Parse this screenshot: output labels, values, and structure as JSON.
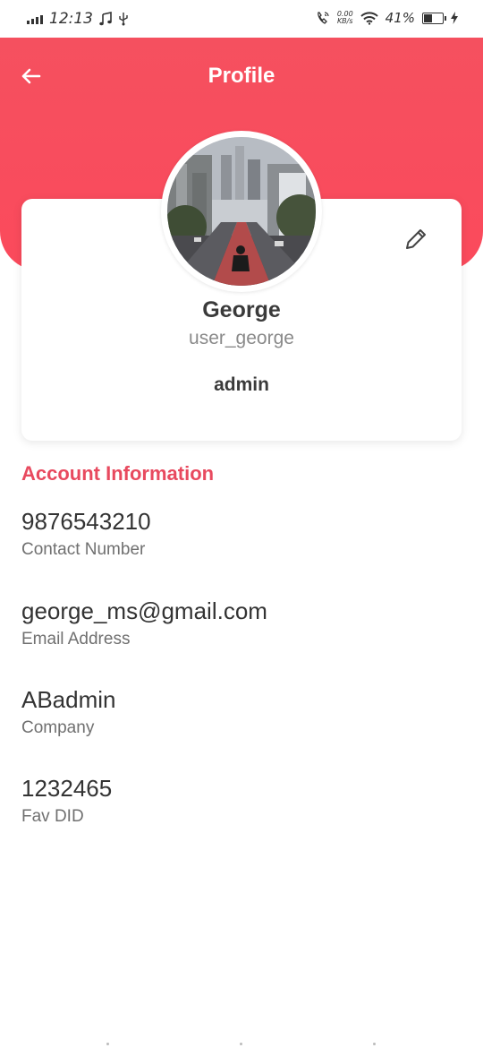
{
  "status_bar": {
    "time": "12:13",
    "net_speed_value": "0.00",
    "net_speed_unit": "KB/s",
    "battery_percent": "41%",
    "battery_level": 0.41
  },
  "header": {
    "title": "Profile",
    "accent_color": "#f5505f"
  },
  "profile": {
    "name": "George",
    "username": "user_george",
    "role": "admin"
  },
  "account_section": {
    "title": "Account Information",
    "title_color": "#e84a5f",
    "items": [
      {
        "value": "9876543210",
        "label": "Contact Number"
      },
      {
        "value": "george_ms@gmail.com",
        "label": "Email Address"
      },
      {
        "value": "ABadmin",
        "label": "Company"
      },
      {
        "value": "1232465",
        "label": "Fav DID"
      }
    ]
  },
  "icons": {
    "back": "arrow-left-icon",
    "edit": "pencil-icon"
  }
}
